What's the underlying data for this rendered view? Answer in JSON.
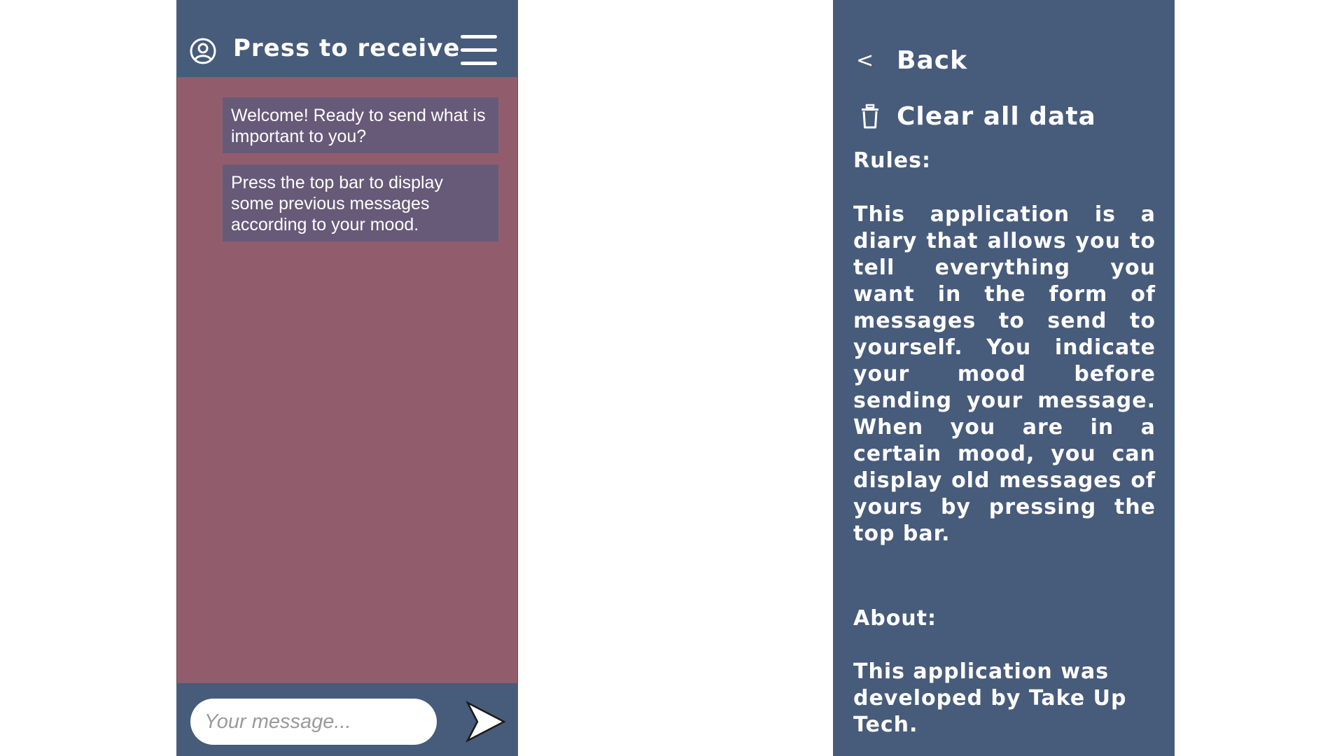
{
  "chat_screen": {
    "topbar": {
      "title": "Press to receive",
      "profile_icon": "user-circle-icon",
      "menu_icon": "hamburger-menu-icon"
    },
    "messages": [
      {
        "text": "Welcome! Ready to send what is important to you?"
      },
      {
        "text": "Press the top bar to display some previous messages according to your mood."
      }
    ],
    "composer": {
      "placeholder": "Your message...",
      "value": "",
      "send_icon": "send-arrow-icon"
    }
  },
  "menu_screen": {
    "back": {
      "icon": "<",
      "label": "Back"
    },
    "clear": {
      "icon": "trash-icon",
      "label": "Clear all data"
    },
    "rules": {
      "heading": "Rules:",
      "body": "This application is a diary that allows you to tell everything you want in the form of messages to send to yourself. You indicate your mood before sending your message. When you are in a certain mood, you can display old messages of yours by pressing the top bar."
    },
    "about": {
      "heading": "About:",
      "body": "This application was developed by Take Up Tech."
    }
  },
  "colors": {
    "bar_background": "#475b7b",
    "chat_background": "#915d6c",
    "bubble_background": "#675a78",
    "text": "#ffffff",
    "page_background": "#ffffff"
  }
}
